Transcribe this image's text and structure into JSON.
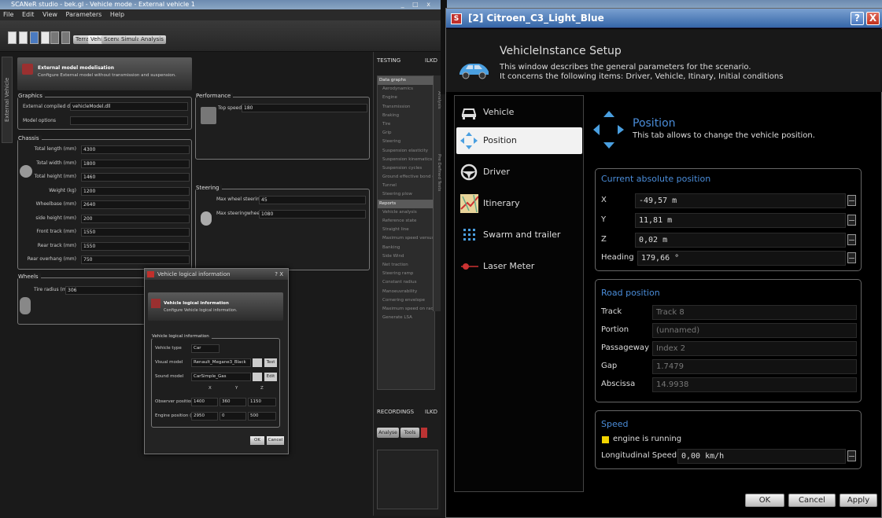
{
  "bg_window": {
    "title": "SCANeR studio - bek.gl - Vehicle mode - External vehicle 1",
    "menu": [
      "File",
      "Edit",
      "View",
      "Parameters",
      "Help"
    ],
    "mode_buttons": [
      "Terrain",
      "Vehicle",
      "Scenario",
      "Simulation",
      "Analysis"
    ],
    "side_tab": "External Vehicle",
    "model_header": {
      "title": "External model modelisation",
      "subtitle": "Configure External model without transmission and suspension."
    },
    "graphics": {
      "title": "Graphics",
      "dll_label": "External compiled dll name",
      "dll_value": "vehicleModel.dll",
      "options_label": "Model options"
    },
    "performance": {
      "title": "Performance",
      "top_speed_label": "Top speed (km/h)",
      "top_speed_value": "180"
    },
    "chassis": {
      "title": "Chassis",
      "rows": [
        {
          "label": "Total length (mm)",
          "value": "4300"
        },
        {
          "label": "Total width (mm)",
          "value": "1800"
        },
        {
          "label": "Total height (mm)",
          "value": "1460"
        },
        {
          "label": "Weight (kg)",
          "value": "1200"
        },
        {
          "label": "Wheelbase (mm)",
          "value": "2640"
        },
        {
          "label": "side height (mm)",
          "value": "200"
        },
        {
          "label": "Front track (mm)",
          "value": "1550"
        },
        {
          "label": "Rear track (mm)",
          "value": "1550"
        },
        {
          "label": "Rear overhang (mm)",
          "value": "750"
        }
      ]
    },
    "steering": {
      "title": "Steering",
      "wheel_angle_label": "Max wheel steering angle (°)",
      "wheel_angle_value": "45",
      "sw_angle_label": "Max steeringwheel angle (°)",
      "sw_angle_value": "1080"
    },
    "wheels": {
      "title": "Wheels",
      "tire_label": "Tire radius (mm)",
      "tire_value": "306"
    },
    "testing": {
      "title": "TESTING",
      "key": "ILKD",
      "tree": [
        {
          "label": "Data graphs",
          "section": true
        },
        {
          "label": "Aerodynamics"
        },
        {
          "label": "Engine"
        },
        {
          "label": "Transmission"
        },
        {
          "label": "Braking"
        },
        {
          "label": "Tire"
        },
        {
          "label": "Grip"
        },
        {
          "label": "Steering"
        },
        {
          "label": "Suspension elasticity"
        },
        {
          "label": "Suspension kinematics"
        },
        {
          "label": "Suspension cycles"
        },
        {
          "label": "Ground effective bond (GE..."
        },
        {
          "label": "Tunnel"
        },
        {
          "label": "Steering plow"
        },
        {
          "label": "Reports",
          "section": true
        },
        {
          "label": "Vehicle analysis"
        },
        {
          "label": "Reference state"
        },
        {
          "label": "Straight line"
        },
        {
          "label": "Maximum speed versus gr..."
        },
        {
          "label": "Banking"
        },
        {
          "label": "Side Wind"
        },
        {
          "label": "Net traction"
        },
        {
          "label": "Steering ramp"
        },
        {
          "label": "Constant radius"
        },
        {
          "label": "Manoeuvrability"
        },
        {
          "label": "Cornering envelope"
        },
        {
          "label": "Maximum speed on radius"
        },
        {
          "label": "Generate LSA"
        }
      ],
      "vtab1": "Analysis",
      "vtab2": "Pre Defined Tests"
    },
    "recordings": {
      "title": "RECORDINGS",
      "key": "ILKD",
      "analyse": "Analyse",
      "tools": "Tools"
    }
  },
  "vl_dialog": {
    "title": "Vehicle logical information",
    "controls": "? X",
    "header_title": "Vehicle logical information",
    "header_sub": "Configure Vehicle logical information.",
    "group": "Vehicle logical information",
    "type_label": "Vehicle type",
    "type_value": "Car",
    "visual_label": "Visual model",
    "visual_value": "Renault_Megane3_Black",
    "visual_btn": "Test",
    "sound_label": "Sound model",
    "sound_value": "CarSimple_Gas",
    "sound_btn": "Edit",
    "col_x": "X",
    "col_y": "Y",
    "col_z": "Z",
    "obs_label": "Observer position (mm)",
    "obs_x": "1400",
    "obs_y": "360",
    "obs_z": "1150",
    "eng_label": "Engine position (mm)",
    "eng_x": "2950",
    "eng_y": "0",
    "eng_z": "500",
    "ok": "OK",
    "cancel": "Cancel"
  },
  "main_dialog": {
    "title": "[2] Citroen_C3_Light_Blue",
    "help_btn": "?",
    "close_btn": "X",
    "heading": "VehicleInstance Setup",
    "desc1": "This window describes the general parameters for the scenario.",
    "desc2": "It concerns the following items: Driver, Vehicle, Itinary, Initial conditions",
    "nav": [
      {
        "label": "Vehicle",
        "icon": "car-icon"
      },
      {
        "label": "Position",
        "icon": "position-arrows-icon",
        "selected": true
      },
      {
        "label": "Driver",
        "icon": "steering-wheel-icon"
      },
      {
        "label": "Itinerary",
        "icon": "map-icon"
      },
      {
        "label": "Swarm and trailer",
        "icon": "swarm-grid-icon"
      },
      {
        "label": "Laser Meter",
        "icon": "laser-icon"
      }
    ],
    "section_title": "Position",
    "section_desc": "This tab allows to change the vehicle position.",
    "current": {
      "title": "Current absolute position",
      "x_label": "X",
      "x_value": "-49,57 m",
      "y_label": "Y",
      "y_value": "11,81 m",
      "z_label": "Z",
      "z_value": "0,02 m",
      "heading_label": "Heading",
      "heading_value": "179,66 °"
    },
    "road": {
      "title": "Road position",
      "track_label": "Track",
      "track_value": "Track 8",
      "portion_label": "Portion",
      "portion_value": "(unnamed)",
      "passage_label": "Passageway",
      "passage_value": "Index 2",
      "gap_label": "Gap",
      "gap_value": "1.7479",
      "abscissa_label": "Abscissa",
      "abscissa_value": "14.9938"
    },
    "speed": {
      "title": "Speed",
      "engine_label": "engine is running",
      "long_label": "Longitudinal Speed",
      "long_value": "0,00 km/h"
    },
    "buttons": {
      "ok": "OK",
      "cancel": "Cancel",
      "apply": "Apply"
    },
    "colors": {
      "accent": "#4a8cd8",
      "titlebar": "#3566a8",
      "engine_indicator": "#f2d400"
    }
  }
}
